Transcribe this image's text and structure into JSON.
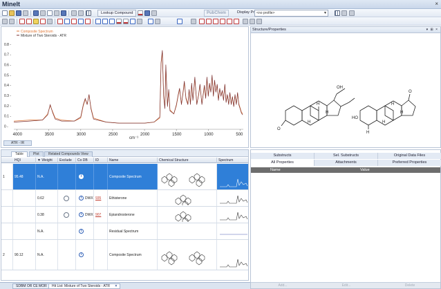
{
  "app": {
    "title": "MineIt",
    "close_glyph": "×"
  },
  "toolbar": {
    "lookup_label": "Lookup Compound",
    "pubchem_label": "PubChem",
    "display_profiles_label": "Display Profiles",
    "profile_value": "<no profile>"
  },
  "spectrum": {
    "legend": [
      "Composite Spectrum",
      "Mixture of Two Steroids - ATR"
    ],
    "x_unit": "cm⁻¹",
    "view_tab": "ATR - IR",
    "colors": {
      "composite": "#e07a3a",
      "mixture": "#7a2f2f"
    }
  },
  "chart_data": {
    "type": "line",
    "title": "",
    "xlabel": "cm⁻¹",
    "ylabel": "",
    "x_reversed": true,
    "xlim": [
      4050,
      450
    ],
    "ylim": [
      -0.03,
      0.9
    ],
    "xticks": [
      4000,
      3500,
      3000,
      2500,
      2000,
      1500,
      1000,
      500
    ],
    "yticks": [
      0,
      0.1,
      0.2,
      0.3,
      0.4,
      0.5,
      0.6,
      0.7,
      0.8
    ],
    "ytick_labels": [
      "0 -",
      "0.1 -",
      "0.2 -",
      "0.3 -",
      "0.4 -",
      "0.5 -",
      "0.6 -",
      "0.7 -",
      "0.8 -"
    ],
    "series": [
      {
        "name": "Composite Spectrum",
        "x": [
          4050,
          3800,
          3600,
          3520,
          3480,
          3440,
          3400,
          3300,
          3100,
          3000,
          2960,
          2930,
          2900,
          2870,
          2840,
          2800,
          2600,
          2400,
          2200,
          2000,
          1850,
          1760,
          1740,
          1720,
          1700,
          1680,
          1665,
          1640,
          1620,
          1600,
          1540,
          1500,
          1470,
          1450,
          1420,
          1400,
          1375,
          1350,
          1320,
          1300,
          1280,
          1260,
          1240,
          1210,
          1180,
          1150,
          1130,
          1100,
          1080,
          1060,
          1040,
          1020,
          1000,
          980,
          960,
          940,
          920,
          900,
          880,
          860,
          840,
          820,
          800,
          780,
          760,
          740,
          720,
          700,
          680,
          660,
          640,
          620,
          600,
          580,
          560,
          540,
          520,
          500,
          480,
          460
        ],
        "values": [
          0.05,
          0.06,
          0.06,
          0.12,
          0.2,
          0.14,
          0.08,
          0.06,
          0.05,
          0.08,
          0.2,
          0.26,
          0.22,
          0.3,
          0.18,
          0.08,
          0.04,
          0.03,
          0.03,
          0.03,
          0.04,
          0.08,
          0.6,
          0.72,
          0.3,
          0.18,
          0.58,
          0.2,
          0.35,
          0.16,
          0.12,
          0.2,
          0.3,
          0.36,
          0.22,
          0.3,
          0.42,
          0.28,
          0.22,
          0.35,
          0.22,
          0.4,
          0.26,
          0.46,
          0.22,
          0.3,
          0.4,
          0.22,
          0.3,
          0.38,
          0.28,
          0.46,
          0.3,
          0.4,
          0.34,
          0.48,
          0.3,
          0.44,
          0.34,
          0.4,
          0.26,
          0.36,
          0.3,
          0.34,
          0.26,
          0.4,
          0.24,
          0.3,
          0.22,
          0.32,
          0.22,
          0.28,
          0.2,
          0.3,
          0.22,
          0.32,
          0.22,
          0.18,
          0.14,
          0.12
        ]
      },
      {
        "name": "Mixture of Two Steroids - ATR",
        "x": [
          4050,
          3800,
          3600,
          3520,
          3480,
          3440,
          3400,
          3300,
          3100,
          3000,
          2960,
          2930,
          2900,
          2870,
          2840,
          2800,
          2600,
          2400,
          2200,
          2000,
          1850,
          1760,
          1740,
          1720,
          1700,
          1680,
          1665,
          1640,
          1620,
          1600,
          1540,
          1500,
          1470,
          1450,
          1420,
          1400,
          1375,
          1350,
          1320,
          1300,
          1280,
          1260,
          1240,
          1210,
          1180,
          1150,
          1130,
          1100,
          1080,
          1060,
          1040,
          1020,
          1000,
          980,
          960,
          940,
          920,
          900,
          880,
          860,
          840,
          820,
          800,
          780,
          760,
          740,
          720,
          700,
          680,
          660,
          640,
          620,
          600,
          580,
          560,
          540,
          520,
          500,
          480,
          460
        ],
        "values": [
          0.04,
          0.05,
          0.06,
          0.11,
          0.21,
          0.13,
          0.07,
          0.05,
          0.05,
          0.09,
          0.21,
          0.27,
          0.21,
          0.31,
          0.17,
          0.07,
          0.04,
          0.03,
          0.03,
          0.03,
          0.04,
          0.09,
          0.62,
          0.74,
          0.29,
          0.17,
          0.6,
          0.19,
          0.36,
          0.15,
          0.12,
          0.21,
          0.31,
          0.37,
          0.21,
          0.31,
          0.44,
          0.27,
          0.21,
          0.36,
          0.21,
          0.42,
          0.25,
          0.48,
          0.21,
          0.31,
          0.41,
          0.21,
          0.31,
          0.4,
          0.27,
          0.48,
          0.29,
          0.42,
          0.33,
          0.5,
          0.29,
          0.45,
          0.33,
          0.41,
          0.25,
          0.37,
          0.29,
          0.35,
          0.25,
          0.41,
          0.23,
          0.31,
          0.21,
          0.33,
          0.21,
          0.29,
          0.19,
          0.31,
          0.21,
          0.33,
          0.21,
          0.17,
          0.13,
          0.11
        ]
      }
    ]
  },
  "structure_panel": {
    "title": "Structure/Properties",
    "controls": "▾ ⊞ ×",
    "atoms": {
      "left": {
        "oh": "OH",
        "o": "O",
        "h1": "H",
        "h2": "H",
        "h3": "H"
      },
      "right": {
        "o": "O",
        "ho": "HO",
        "h1": "H",
        "h2": "H",
        "h3": "H",
        "h4": "H"
      }
    }
  },
  "table": {
    "tabs": [
      "Table",
      "Plot",
      "Related Compounds View"
    ],
    "columns": [
      "HQI",
      "▼ Weight",
      "Exclude",
      "Co DB",
      "ID",
      "Name",
      "Chemical Structure",
      "Spectrum"
    ],
    "rows": [
      {
        "num": "1",
        "hqi": "95.48",
        "weight": "N.A.",
        "radio": false,
        "db": "",
        "id": "",
        "name": "Composite Spectrum",
        "selected": true
      },
      {
        "num": "",
        "hqi": "",
        "weight": "0.62",
        "radio": true,
        "db": "DWX",
        "id": "935",
        "name": "Ethisterone",
        "selected": false
      },
      {
        "num": "",
        "hqi": "",
        "weight": "0.38",
        "radio": true,
        "db": "DWX",
        "id": "907",
        "name": "Epiandrosterone",
        "selected": false
      },
      {
        "num": "",
        "hqi": "",
        "weight": "N.A.",
        "radio": false,
        "db": "",
        "id": "",
        "name": "Residual Spectrum",
        "selected": false
      },
      {
        "num": "2",
        "hqi": "90.12",
        "weight": "N.A.",
        "radio": false,
        "db": "",
        "id": "",
        "name": "Composite Spectrum",
        "selected": false
      }
    ]
  },
  "bottom_tabs": [
    "SDBM OR CE MOR",
    "Hit List: Mixture of Two Steroids - ATR"
  ],
  "properties": {
    "tabs_row1": [
      "Substructs",
      "Sel. Substructs",
      "Original Data Files"
    ],
    "tabs_row2": [
      "All Properties",
      "Attachments",
      "Preferred Properties"
    ],
    "columns": [
      "Name",
      "Value"
    ],
    "buttons": [
      "Add...",
      "Edit...",
      "Delete"
    ]
  }
}
